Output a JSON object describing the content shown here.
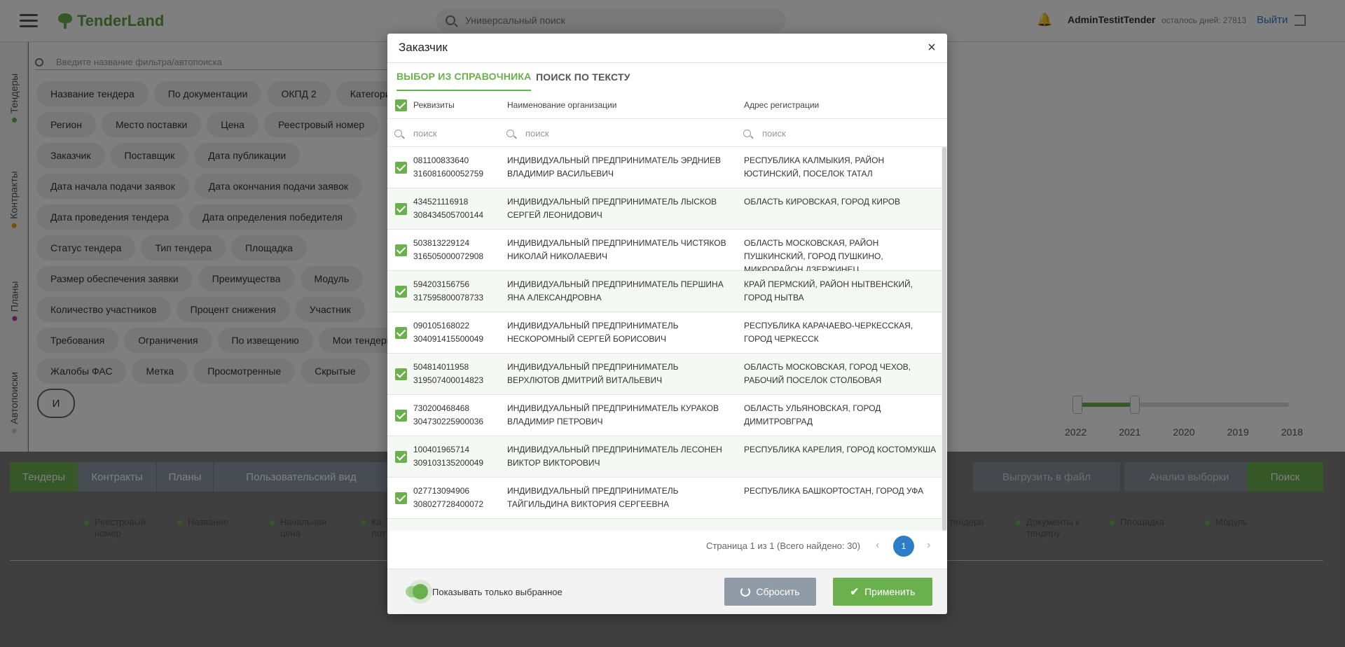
{
  "app": {
    "logo_text": "TenderLand",
    "search_placeholder": "Универсальный поиск",
    "user_name": "AdminTestitTender",
    "days_left": "осталось дней: 27813",
    "logout_label": "Выйти"
  },
  "sidebar": {
    "items": [
      {
        "label": "Тендеры",
        "color": "#6ab04c"
      },
      {
        "label": "Контракты",
        "color": "#f39c12"
      },
      {
        "label": "Планы",
        "color": "#c0398c"
      },
      {
        "label": "Автопоиски",
        "color": "#cccccc"
      }
    ]
  },
  "filters": {
    "search_placeholder": "Введите название фильтра/автопоиска",
    "rows": [
      [
        "Название тендера",
        "По документации",
        "ОКПД 2",
        "Категория"
      ],
      [
        "Регион",
        "Место поставки",
        "Цена",
        "Реестровый номер"
      ],
      [
        "Заказчик",
        "Поставщик",
        "Дата публикации"
      ],
      [
        "Дата начала подачи заявок",
        "Дата окончания подачи заявок"
      ],
      [
        "Дата проведения тендера",
        "Дата определения победителя"
      ],
      [
        "Статус тендера",
        "Тип тендера",
        "Площадка"
      ],
      [
        "Размер обеспечения заявки",
        "Преимущества",
        "Модуль"
      ],
      [
        "Количество участников",
        "Процент снижения",
        "Участник"
      ],
      [
        "Требования",
        "Ограничения",
        "По извещению",
        "Мои тендеры"
      ],
      [
        "Жалобы ФАС",
        "Метка",
        "Просмотренные",
        "Скрытые"
      ]
    ],
    "logic_button": "И"
  },
  "years": [
    "2022",
    "2021",
    "2020",
    "2019",
    "2018"
  ],
  "bottom_tabs": {
    "tenders": "Тендеры",
    "contracts": "Контракты",
    "plans": "Планы",
    "custom_view": "Пользовательский вид",
    "export": "Выгрузить в файл",
    "analysis": "Анализ выборки",
    "search": "Поиск"
  },
  "columns": [
    "Реестровый номер",
    "Название",
    "Начальная цена",
    "Ка лот",
    "тендера",
    "Документы к тендеру",
    "Площадка",
    "Модуль"
  ],
  "modal": {
    "title": "Заказчик",
    "close": "×",
    "tabs": {
      "active": "ВЫБОР ИЗ СПРАВОЧНИКА",
      "inactive": "ПОИСК ПО ТЕКСТУ"
    },
    "headers": {
      "req": "Реквизиты",
      "org": "Наименование организации",
      "addr": "Адрес регистрации"
    },
    "search_placeholder": "поиск",
    "rows": [
      {
        "inn": "081100833640",
        "ogrn": "316081600052759",
        "org": "ИНДИВИДУАЛЬНЫЙ ПРЕДПРИНИМАТЕЛЬ ЭРДНИЕВ ВЛАДИМИР ВАСИЛЬЕВИЧ",
        "addr": "РЕСПУБЛИКА КАЛМЫКИЯ, РАЙОН ЮСТИНСКИЙ, ПОСЕЛОК ТАТАЛ"
      },
      {
        "inn": "434521116918",
        "ogrn": "308434505700144",
        "org": "ИНДИВИДУАЛЬНЫЙ ПРЕДПРИНИМАТЕЛЬ ЛЫСКОВ СЕРГЕЙ ЛЕОНИДОВИЧ",
        "addr": "ОБЛАСТЬ КИРОВСКАЯ, ГОРОД КИРОВ"
      },
      {
        "inn": "503813229124",
        "ogrn": "316505000072908",
        "org": "ИНДИВИДУАЛЬНЫЙ ПРЕДПРИНИМАТЕЛЬ ЧИСТЯКОВ НИКОЛАЙ НИКОЛАЕВИЧ",
        "addr": "ОБЛАСТЬ МОСКОВСКАЯ, РАЙОН ПУШКИНСКИЙ, ГОРОД ПУШКИНО, МИКРОРАЙОН ДЗЕРЖИНЕЦ"
      },
      {
        "inn": "594203156756",
        "ogrn": "317595800078733",
        "org": "ИНДИВИДУАЛЬНЫЙ ПРЕДПРИНИМАТЕЛЬ ПЕРШИНА ЯНА АЛЕКСАНДРОВНА",
        "addr": "КРАЙ ПЕРМСКИЙ, РАЙОН НЫТВЕНСКИЙ, ГОРОД НЫТВА"
      },
      {
        "inn": "090105168022",
        "ogrn": "304091415500049",
        "org": "ИНДИВИДУАЛЬНЫЙ ПРЕДПРИНИМАТЕЛЬ НЕСКОРОМНЫЙ СЕРГЕЙ БОРИСОВИЧ",
        "addr": "РЕСПУБЛИКА КАРАЧАЕВО-ЧЕРКЕССКАЯ, ГОРОД ЧЕРКЕССК"
      },
      {
        "inn": "504814011958",
        "ogrn": "319507400014823",
        "org": "ИНДИВИДУАЛЬНЫЙ ПРЕДПРИНИМАТЕЛЬ ВЕРХЛЮТОВ ДМИТРИЙ ВИТАЛЬЕВИЧ",
        "addr": "ОБЛАСТЬ МОСКОВСКАЯ, ГОРОД ЧЕХОВ, РАБОЧИЙ ПОСЕЛОК СТОЛБОВАЯ"
      },
      {
        "inn": "730200468468",
        "ogrn": "304730225900036",
        "org": "ИНДИВИДУАЛЬНЫЙ ПРЕДПРИНИМАТЕЛЬ КУРАКОВ ВЛАДИМИР ПЕТРОВИЧ",
        "addr": "ОБЛАСТЬ УЛЬЯНОВСКАЯ, ГОРОД ДИМИТРОВГРАД"
      },
      {
        "inn": "100401965714",
        "ogrn": "309103135200049",
        "org": "ИНДИВИДУАЛЬНЫЙ ПРЕДПРИНИМАТЕЛЬ ЛЕСОНЕН ВИКТОР ВИКТОРОВИЧ",
        "addr": "РЕСПУБЛИКА КАРЕЛИЯ, ГОРОД КОСТОМУКША"
      },
      {
        "inn": "027713094906",
        "ogrn": "308027728400072",
        "org": "ИНДИВИДУАЛЬНЫЙ ПРЕДПРИНИМАТЕЛЬ ТАЙГИЛЬДИНА ВИКТОРИЯ СЕРГЕЕВНА",
        "addr": "РЕСПУБЛИКА БАШКОРТОСТАН, ГОРОД УФА"
      },
      {
        "inn": "",
        "ogrn": "",
        "org": "",
        "addr": ""
      }
    ],
    "pager": {
      "info": "Страница 1 из 1 (Всего найдено: 30)",
      "current": "1"
    },
    "toggle_label": "Показывать только выбранное",
    "reset_label": "Сбросить",
    "apply_label": "Применить"
  }
}
